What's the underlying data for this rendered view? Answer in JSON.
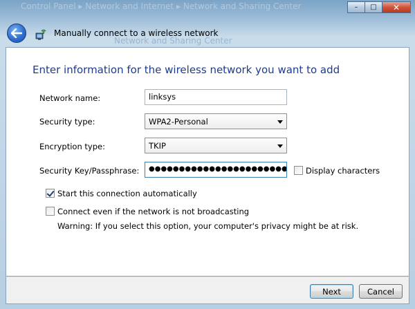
{
  "window": {
    "title_bg": "Control Panel ▸ Network and Internet ▸ Network and Sharing Center",
    "subtitle_bg": "Network and Sharing Center",
    "nav_title": "Manually connect to a wireless network",
    "controls": {
      "minimize": "–",
      "maximize": "□",
      "close": "✕"
    }
  },
  "form": {
    "heading": "Enter information for the wireless network you want to add",
    "network_name_label": "Network name:",
    "network_name_value": "linksys",
    "security_type_label": "Security type:",
    "security_type_value": "WPA2-Personal",
    "encryption_type_label": "Encryption type:",
    "encryption_type_value": "TKIP",
    "key_label": "Security Key/Passphrase:",
    "key_value": "●●●●●●●●●●●●●●●●●●●●●●●●●●●●●●●",
    "display_characters_label": "Display characters",
    "display_characters_checked": false,
    "start_auto_label": "Start this connection automatically",
    "start_auto_checked": true,
    "connect_even_label": "Connect even if the network is not broadcasting",
    "connect_even_checked": false,
    "warning": "Warning: If you select this option, your computer's privacy might be at risk."
  },
  "footer": {
    "next_label": "Next",
    "cancel_label": "Cancel"
  },
  "colors": {
    "heading": "#1e3c8c",
    "back_button": "#2d6fd1"
  },
  "icons": {
    "back": "back-arrow-icon",
    "network": "wireless-network-icon",
    "dropdown": "chevron-down-icon"
  }
}
